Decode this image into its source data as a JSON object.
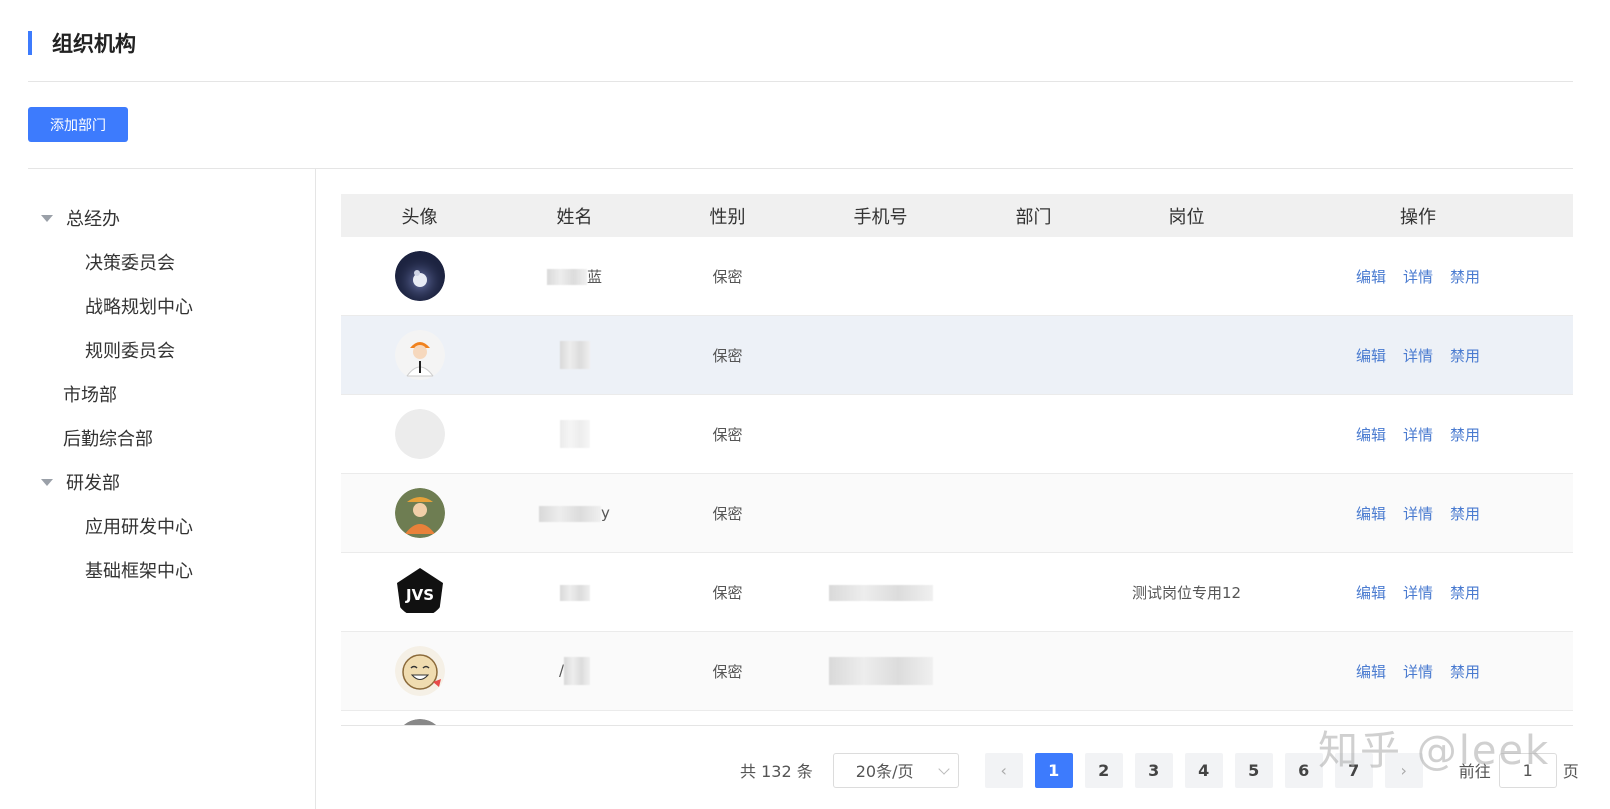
{
  "header": {
    "title": "组织机构"
  },
  "toolbar": {
    "add_dept_label": "添加部门"
  },
  "tree": [
    {
      "label": "总经办",
      "level": 1,
      "expanded": true
    },
    {
      "label": "决策委员会",
      "level": 2
    },
    {
      "label": "战略规划中心",
      "level": 2
    },
    {
      "label": "规则委员会",
      "level": 2
    },
    {
      "label": "市场部",
      "level": 1
    },
    {
      "label": "后勤综合部",
      "level": 1
    },
    {
      "label": "研发部",
      "level": 1,
      "expanded": true
    },
    {
      "label": "应用研发中心",
      "level": 2
    },
    {
      "label": "基础框架中心",
      "level": 2
    }
  ],
  "table": {
    "columns": [
      "头像",
      "姓名",
      "性别",
      "手机号",
      "部门",
      "岗位",
      "操作"
    ],
    "rows": [
      {
        "avatar": "moon-avatar",
        "name": "蓝",
        "gender": "保密",
        "phone": "",
        "dept": "",
        "post": ""
      },
      {
        "avatar": "worker-avatar",
        "name": "",
        "gender": "保密",
        "phone": "",
        "dept": "",
        "post": ""
      },
      {
        "avatar": "blank-avatar",
        "name": "",
        "gender": "保密",
        "phone": "",
        "dept": "",
        "post": ""
      },
      {
        "avatar": "photo-avatar",
        "name": "y",
        "gender": "保密",
        "phone": "",
        "dept": "",
        "post": ""
      },
      {
        "avatar": "jvs-avatar",
        "name": "",
        "gender": "保密",
        "phone": "",
        "dept": "",
        "post": "测试岗位专用12"
      },
      {
        "avatar": "cartoon-avatar",
        "name": "/",
        "gender": "保密",
        "phone": "",
        "dept": "",
        "post": ""
      }
    ],
    "actions": {
      "edit": "编辑",
      "detail": "详情",
      "disable": "禁用"
    },
    "avatar_text": {
      "jvs": "JVS"
    }
  },
  "pagination": {
    "total": "共 132 条",
    "page_size": "20条/页",
    "prev": "‹",
    "next": "›",
    "pages": [
      "1",
      "2",
      "3",
      "4",
      "5",
      "6",
      "7"
    ],
    "current": "1",
    "goto_prefix": "前往",
    "goto_value": "1",
    "goto_suffix": "页"
  },
  "watermark": "知乎 @leek",
  "colors": {
    "primary": "#3d7bfd",
    "link": "#4a7bd0",
    "header_bg": "#f0f0f0",
    "hover_row": "#edf1f7"
  }
}
